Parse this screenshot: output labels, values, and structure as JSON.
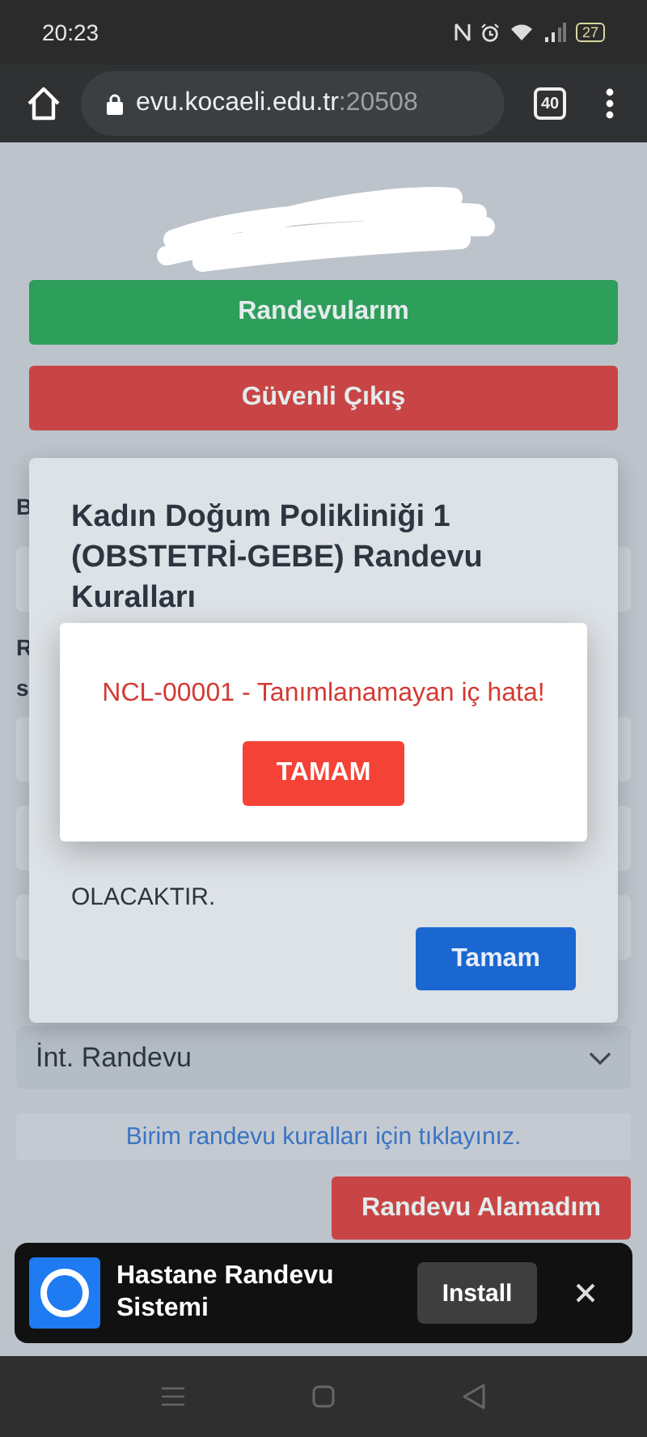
{
  "status_bar": {
    "time": "20:23",
    "battery": "27"
  },
  "browser": {
    "url_host": "evu.kocaeli.edu.tr",
    "url_port": ":20508",
    "tab_count": "40"
  },
  "page": {
    "buttons": [
      {
        "label": "Randevularım",
        "kind": "success"
      },
      {
        "label": "Güvenli Çıkış",
        "kind": "danger"
      }
    ],
    "label_fragments": [
      "B",
      "R",
      "s"
    ],
    "select": {
      "value": "İnt. Randevu"
    },
    "rules_link": "Birim randevu kuralları için tıklayınız.",
    "fail_button": "Randevu Alamadım"
  },
  "rules_modal": {
    "title": "Kadın Doğum Polikliniği 1 (OBSTETRİ-GEBE) Randevu Kuralları",
    "body_visible": "OLACAKTIR.",
    "button": "Tamam"
  },
  "error_alert": {
    "message": "NCL-00001 - Tanımlanamayan iç hata!",
    "button": "TAMAM"
  },
  "install_banner": {
    "app_name": "Hastane Randevu Sistemi",
    "button": "Install"
  }
}
